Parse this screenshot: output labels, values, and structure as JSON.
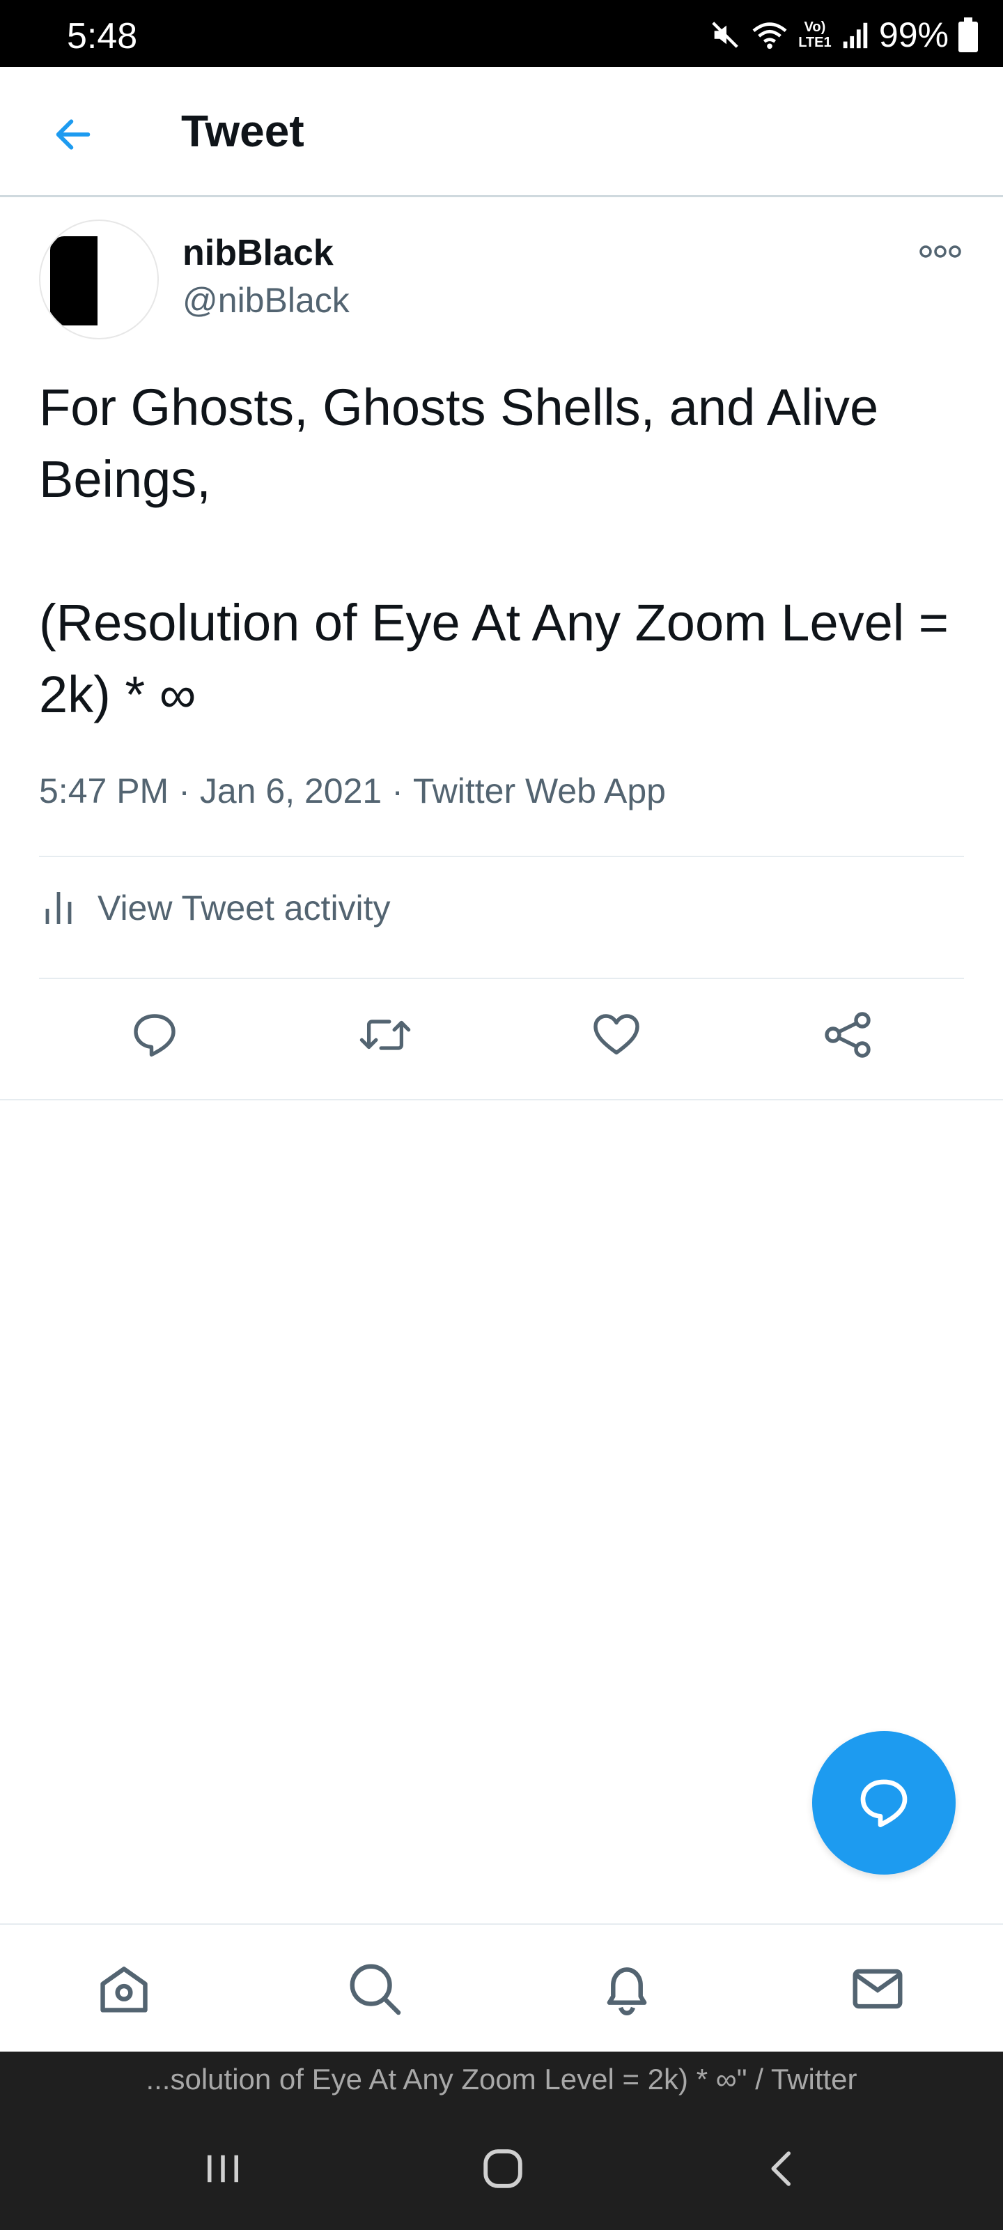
{
  "status_bar": {
    "time": "5:48",
    "network_label": "Vo) LTE1",
    "battery": "99%"
  },
  "header": {
    "title": "Tweet"
  },
  "tweet": {
    "display_name": "nibBlack",
    "handle": "@nibBlack",
    "text": "For Ghosts, Ghosts Shells, and Alive Beings,\n\n(Resolution of Eye At Any Zoom Level = 2k) * ∞",
    "time": "5:47 PM",
    "date": "Jan 6, 2021",
    "source": "Twitter Web App",
    "separator": "·",
    "activity_label": "View Tweet activity"
  },
  "browser": {
    "page_title": "...solution of Eye At Any Zoom Level = 2k) * ∞\" / Twitter"
  },
  "colors": {
    "accent": "#1d9bf0",
    "text_primary": "#0f1419",
    "text_secondary": "#536471",
    "divider": "#e6ecf0"
  },
  "icons": {
    "back": "arrow-left-icon",
    "more": "more-horizontal-icon",
    "activity": "bar-chart-icon",
    "reply": "reply-icon",
    "retweet": "retweet-icon",
    "like": "heart-icon",
    "share": "share-icon",
    "compose": "compose-reply-icon",
    "home": "home-icon",
    "search": "search-icon",
    "notifications": "bell-icon",
    "messages": "mail-icon"
  }
}
